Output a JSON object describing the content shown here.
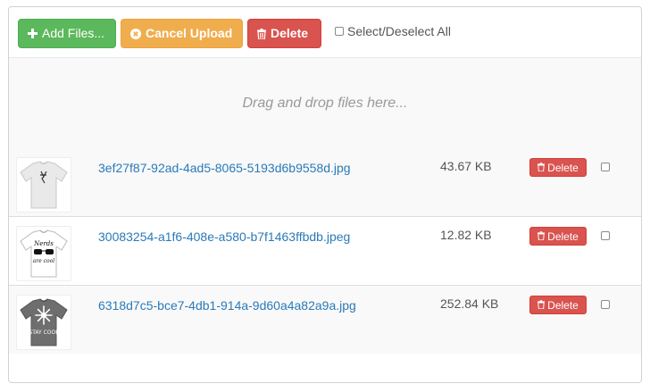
{
  "toolbar": {
    "add_label": "Add Files...",
    "cancel_label": "Cancel Upload",
    "delete_label": "Delete",
    "select_all_label": "Select/Deselect All"
  },
  "dropzone": {
    "text": "Drag and drop files here..."
  },
  "files": [
    {
      "name": "3ef27f87-92ad-4ad5-8065-5193d6b9558d.jpg",
      "size": "43.67 KB",
      "delete_label": "Delete",
      "thumbnail": "white t-shirt with small graphic"
    },
    {
      "name": "30083254-a1f6-408e-a580-b7f1463ffbdb.jpeg",
      "size": "12.82 KB",
      "delete_label": "Delete",
      "thumbnail": "white t-shirt with glasses print"
    },
    {
      "name": "6318d7c5-bce7-4db1-914a-9d60a4a82a9a.jpg",
      "size": "252.84 KB",
      "delete_label": "Delete",
      "thumbnail": "grey t-shirt with snowflake print"
    }
  ],
  "thumbnail_text": {
    "shirt2_top": "Nerds",
    "shirt2_bottom": "are cool",
    "shirt3_bottom": "STAY COOL"
  },
  "colors": {
    "success": "#5cb85c",
    "warning": "#f0ad4e",
    "danger": "#d9534f",
    "link": "#2a7ab8"
  },
  "icons": {
    "add": "plus-icon",
    "cancel": "ban-circle-icon",
    "delete": "trash-icon"
  }
}
